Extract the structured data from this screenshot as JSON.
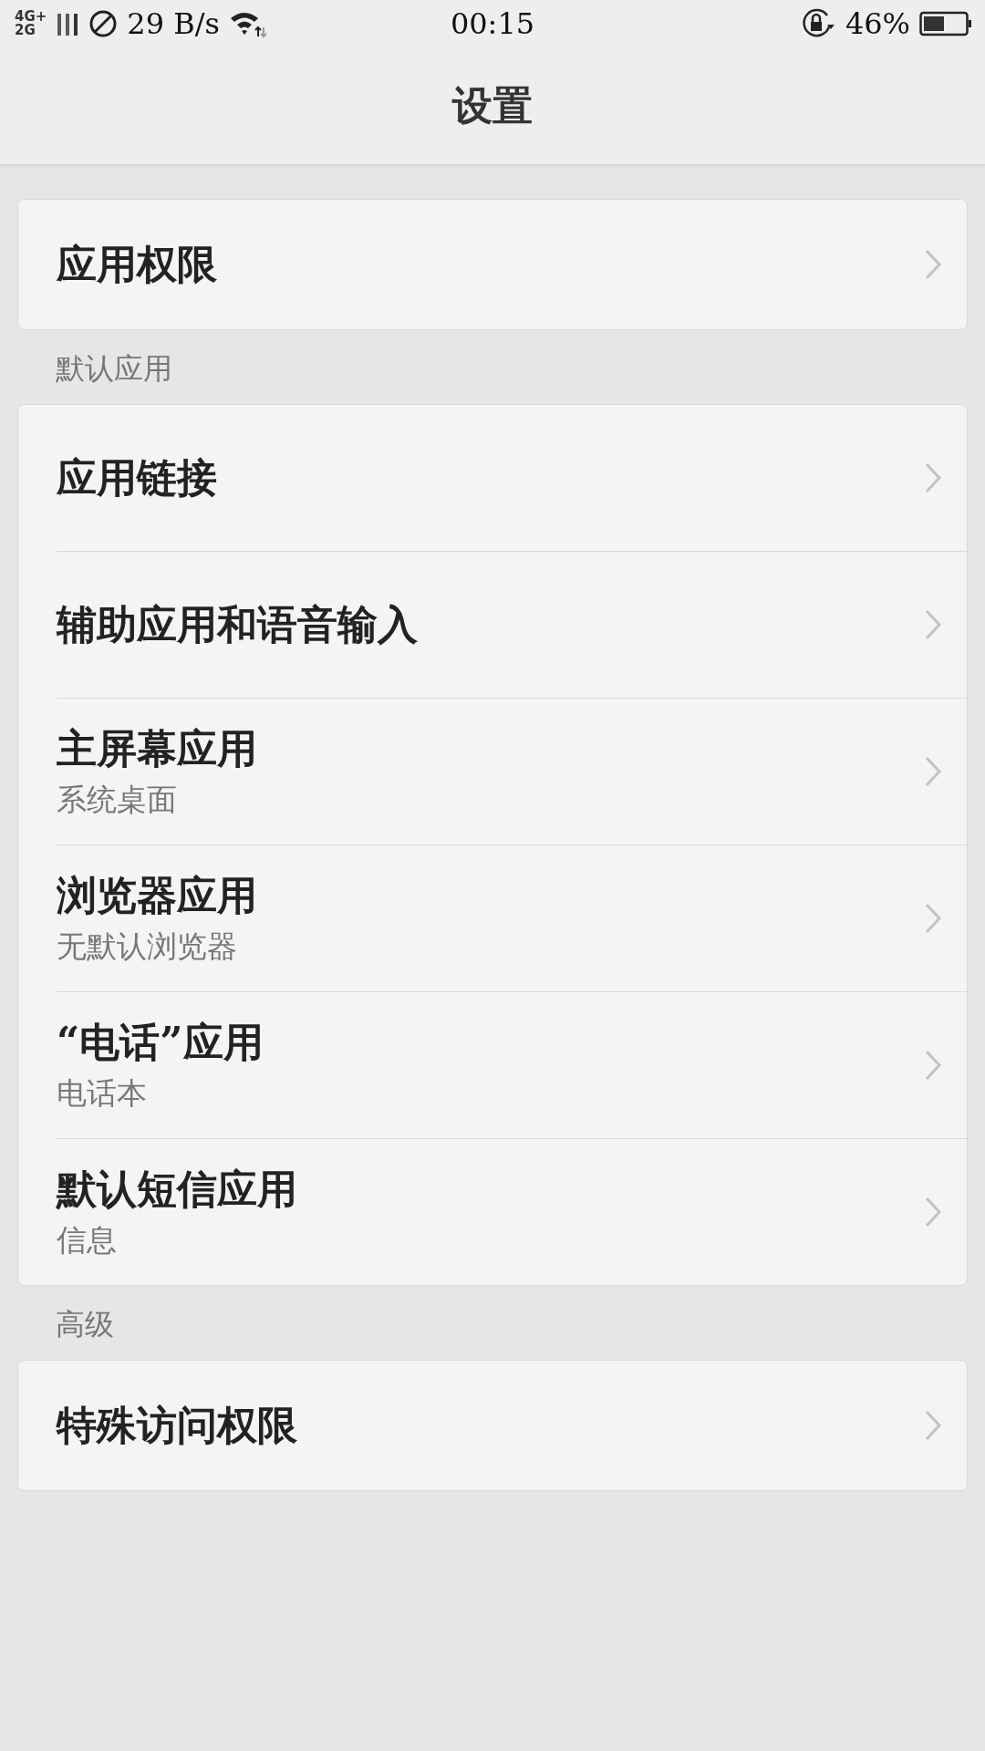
{
  "status_bar": {
    "network_top": "4G+",
    "network_bottom": "2G",
    "speed": "29 B/s",
    "time": "00:15",
    "battery": "46%"
  },
  "header": {
    "title": "设置"
  },
  "sections": [
    {
      "items": [
        {
          "title": "应用权限"
        }
      ]
    },
    {
      "label": "默认应用",
      "items": [
        {
          "title": "应用链接"
        },
        {
          "title": "辅助应用和语音输入"
        },
        {
          "title": "主屏幕应用",
          "subtitle": "系统桌面"
        },
        {
          "title": "浏览器应用",
          "subtitle": "无默认浏览器"
        },
        {
          "title": "“电话”应用",
          "subtitle": "电话本"
        },
        {
          "title": "默认短信应用",
          "subtitle": "信息"
        }
      ]
    },
    {
      "label": "高级",
      "items": [
        {
          "title": "特殊访问权限"
        }
      ]
    }
  ]
}
